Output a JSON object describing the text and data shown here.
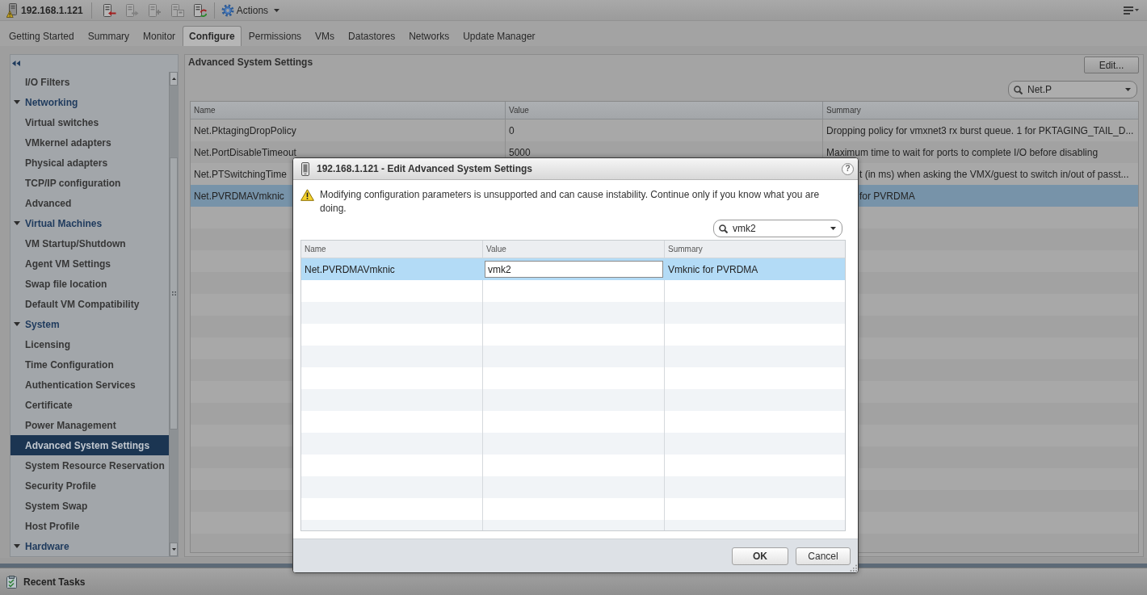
{
  "toolbar": {
    "host": "192.168.1.121",
    "tools": [
      {
        "disabled": false
      },
      {
        "disabled": true
      },
      {
        "disabled": true
      },
      {
        "disabled": true
      },
      {
        "disabled": false
      }
    ],
    "actions": "Actions"
  },
  "tabs": [
    {
      "label": "Getting Started",
      "selected": false
    },
    {
      "label": "Summary",
      "selected": false
    },
    {
      "label": "Monitor",
      "selected": false
    },
    {
      "label": "Configure",
      "selected": true
    },
    {
      "label": "Permissions",
      "selected": false
    },
    {
      "label": "VMs",
      "selected": false
    },
    {
      "label": "Datastores",
      "selected": false
    },
    {
      "label": "Networks",
      "selected": false
    },
    {
      "label": "Update Manager",
      "selected": false
    }
  ],
  "sidebar": {
    "items": [
      {
        "label": "I/O Filters",
        "selected": false
      },
      {
        "label": "Networking",
        "selected": false,
        "expanded": true,
        "children": [
          {
            "label": "Virtual switches",
            "selected": false
          },
          {
            "label": "VMkernel adapters",
            "selected": false
          },
          {
            "label": "Physical adapters",
            "selected": false
          },
          {
            "label": "TCP/IP configuration",
            "selected": false
          },
          {
            "label": "Advanced",
            "selected": false
          }
        ]
      },
      {
        "label": "Virtual Machines",
        "selected": false,
        "expanded": true,
        "children": [
          {
            "label": "VM Startup/Shutdown",
            "selected": false
          },
          {
            "label": "Agent VM Settings",
            "selected": false
          },
          {
            "label": "Swap file location",
            "selected": false
          },
          {
            "label": "Default VM Compatibility",
            "selected": false
          }
        ]
      },
      {
        "label": "System",
        "selected": false,
        "expanded": true,
        "children": [
          {
            "label": "Licensing",
            "selected": false
          },
          {
            "label": "Time Configuration",
            "selected": false
          },
          {
            "label": "Authentication Services",
            "selected": false
          },
          {
            "label": "Certificate",
            "selected": false
          },
          {
            "label": "Power Management",
            "selected": false
          },
          {
            "label": "Advanced System Settings",
            "selected": true
          },
          {
            "label": "System Resource Reservation",
            "selected": false
          },
          {
            "label": "Security Profile",
            "selected": false
          },
          {
            "label": "System Swap",
            "selected": false
          },
          {
            "label": "Host Profile",
            "selected": false
          }
        ]
      },
      {
        "label": "Hardware",
        "selected": false,
        "expanded": true
      }
    ]
  },
  "panel": {
    "title": "Advanced System Settings",
    "edit_button": "Edit...",
    "filter": {
      "value": "Net.P"
    },
    "table": {
      "columns": [
        "Name",
        "Value",
        "Summary"
      ],
      "rows": [
        {
          "name": "Net.PktagingDropPolicy",
          "value": "0",
          "summary": "Dropping policy for vmxnet3 rx burst queue. 1 for PKTAGING_TAIL_D...",
          "selected": false
        },
        {
          "name": "Net.PortDisableTimeout",
          "value": "5000",
          "summary": "Maximum time to wait for ports to complete I/O before disabling",
          "selected": false
        },
        {
          "name": "Net.PTSwitchingTime",
          "summary": "t (in ms) when asking the VMX/guest to switch in/out of passt...",
          "selected": false
        },
        {
          "name": "Net.PVRDMAVmknic",
          "summary": "for PVRDMA",
          "selected": true
        }
      ]
    }
  },
  "dialog": {
    "title": "192.168.1.121 - Edit Advanced System Settings",
    "help": "?",
    "warning": "Modifying configuration parameters is unsupported and can cause instability. Continue only if you know what you are doing.",
    "filter": {
      "value": "vmk2"
    },
    "table": {
      "columns": [
        "Name",
        "Value",
        "Summary"
      ],
      "rows": [
        {
          "name": "Net.PVRDMAVmknic",
          "value": "vmk2",
          "summary": "Vmknic for PVRDMA",
          "selected": true,
          "editing": true
        }
      ]
    },
    "buttons": [
      {
        "label": "OK",
        "default": true
      },
      {
        "label": "Cancel",
        "default": false
      }
    ]
  },
  "recent_tasks": {
    "title": "Recent Tasks"
  }
}
